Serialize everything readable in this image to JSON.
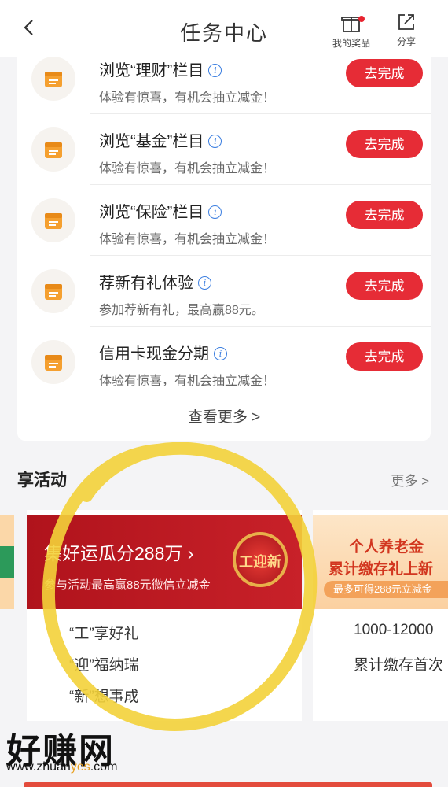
{
  "topbar": {
    "title": "任务中心",
    "prize_label": "我的奖品",
    "share_label": "分享"
  },
  "tasks": [
    {
      "name": "浏览“理财”栏目",
      "desc": "体验有惊喜，有机会抽立减金！",
      "button": "去完成"
    },
    {
      "name": "浏览“基金”栏目",
      "desc": "体验有惊喜，有机会抽立减金！",
      "button": "去完成"
    },
    {
      "name": "浏览“保险”栏目",
      "desc": "体验有惊喜，有机会抽立减金！",
      "button": "去完成"
    },
    {
      "name": "荐新有礼体验",
      "desc": "参加荐新有礼，最高赢88元。",
      "button": "去完成"
    },
    {
      "name": "信用卡现金分期",
      "desc": "体验有惊喜，有机会抽立减金！",
      "button": "去完成"
    }
  ],
  "view_more": "查看更多 >",
  "activities_section": {
    "title": "享活动",
    "more": "更多 >"
  },
  "activity1": {
    "title": "集好运瓜分288万 ›",
    "subtitle": "参与活动最高赢88元微信立减金",
    "medal_text": "工迎新",
    "lines": [
      "“工”享好礼",
      "“迎”福纳瑞",
      "“新”想事成"
    ]
  },
  "activity2": {
    "title": "个人养老金",
    "subtitle": "累计缴存礼上新",
    "pill": "最多可得288元立减金",
    "lines": [
      "1000-12000",
      "累计缴存首次"
    ]
  },
  "watermark": {
    "text": "好赚网",
    "url_prefix": "www.zhuan",
    "url_highlight": "yes",
    "url_suffix": ".com"
  },
  "colors": {
    "accent_red": "#e62c36",
    "icon_orange": "#f5a030",
    "highlight_yellow": "#f3d23a"
  }
}
